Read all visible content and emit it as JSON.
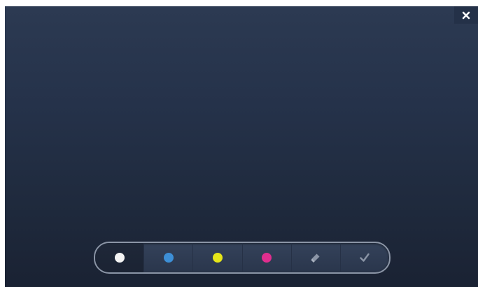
{
  "window": {
    "close_icon": "close-icon"
  },
  "toolbar": {
    "tools": [
      {
        "id": "color-white",
        "icon": "white-color-dot",
        "color": "#f4f4f4",
        "selected": true
      },
      {
        "id": "color-blue",
        "icon": "blue-color-dot",
        "color": "#3d8fd6",
        "selected": false
      },
      {
        "id": "color-yellow",
        "icon": "yellow-color-dot",
        "color": "#e6e619",
        "selected": false
      },
      {
        "id": "color-magenta",
        "icon": "magenta-color-dot",
        "color": "#e02e8e",
        "selected": false
      },
      {
        "id": "eraser",
        "icon": "eraser-icon",
        "selected": false
      },
      {
        "id": "done",
        "icon": "checkmark-icon",
        "selected": false
      }
    ]
  },
  "colors": {
    "background_top": "#2c3a52",
    "background_bottom": "#1a2233",
    "toolbar_border": "#8b95a6",
    "icon_muted": "#8b95a6",
    "close_icon": "#ffffff"
  }
}
